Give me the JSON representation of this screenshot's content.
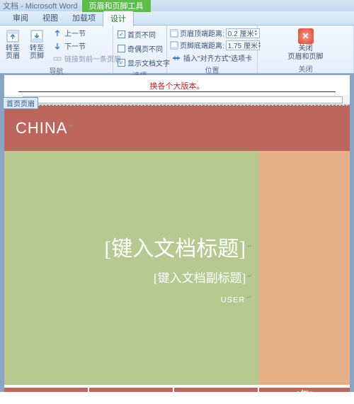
{
  "titlebar": {
    "title": "文档 - Microsoft Word",
    "contextual": "页眉和页脚工具"
  },
  "tabs": {
    "review": "审阅",
    "view": "视图",
    "addins": "加载项",
    "design": "设计"
  },
  "ribbon": {
    "nav": {
      "goto_header": "转至页眉",
      "goto_footer": "转至页脚",
      "prev_section": "上一节",
      "next_section": "下一节",
      "link_previous": "链接到前一条页眉",
      "group": "导航"
    },
    "options": {
      "diff_first": "首页不同",
      "diff_oddeven": "奇偶页不同",
      "show_doc": "显示文档文字",
      "group": "选项"
    },
    "position": {
      "header_top": "页眉顶端距离:",
      "header_top_val": "0.2 厘米",
      "footer_bottom": "页脚底端距离:",
      "footer_bottom_val": "1.75 厘米",
      "insert_align": "插入\"对齐方式\"选项卡",
      "group": "位置"
    },
    "close": {
      "label1": "关闭",
      "label2": "页眉和页脚",
      "group": "关闭"
    }
  },
  "doc": {
    "red_text": "换各个大版本。",
    "header_tag": "首页页眉",
    "china": "CHINA",
    "title_ph": "[键入文档标题]",
    "subtitle_ph": "[键入文档副标题]",
    "user": "USER",
    "year": "[年]",
    "caret": "↵"
  }
}
